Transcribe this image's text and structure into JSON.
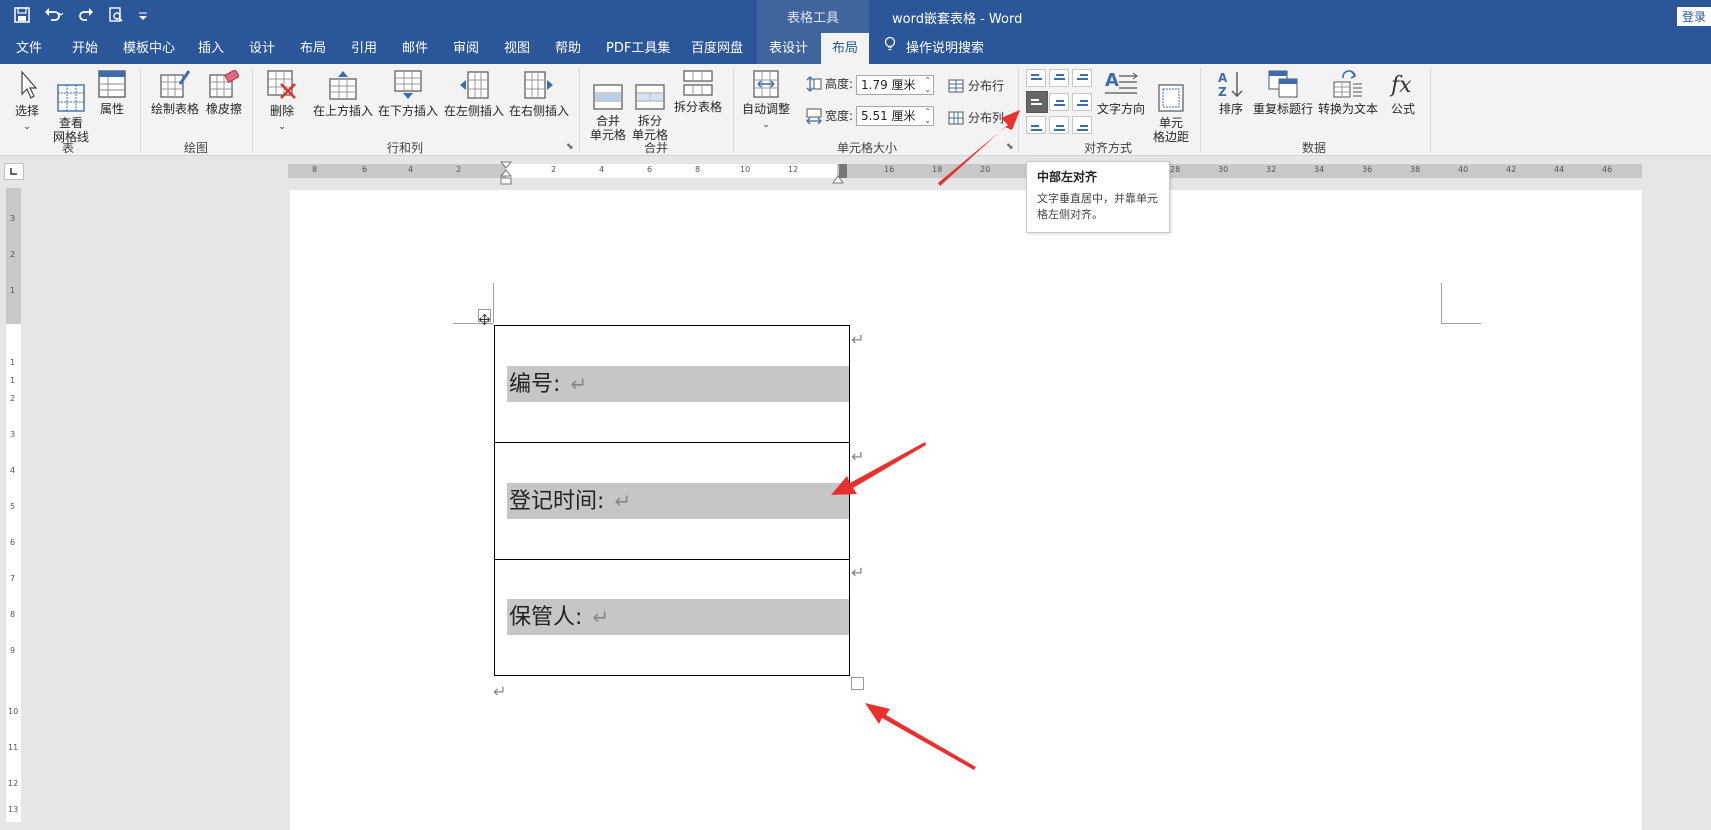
{
  "titlebar": {
    "context_tool": "表格工具",
    "document_title": "word嵌套表格  -  Word",
    "login": "登录",
    "qat_icons": [
      "save-icon",
      "undo-icon",
      "redo-icon",
      "print-preview-icon",
      "customize-icon"
    ]
  },
  "tabs": [
    {
      "label": "文件"
    },
    {
      "label": "开始"
    },
    {
      "label": "模板中心"
    },
    {
      "label": "插入"
    },
    {
      "label": "设计"
    },
    {
      "label": "布局"
    },
    {
      "label": "引用"
    },
    {
      "label": "邮件"
    },
    {
      "label": "审阅"
    },
    {
      "label": "视图"
    },
    {
      "label": "帮助"
    },
    {
      "label": "PDF工具集"
    },
    {
      "label": "百度网盘"
    },
    {
      "label": "表设计"
    },
    {
      "label": "布局"
    }
  ],
  "search_tab": "操作说明搜索",
  "ribbon": {
    "select": "选择",
    "view_grid": "查看\n网格线",
    "properties": "属性",
    "group_table": "表",
    "draw_table": "绘制表格",
    "eraser": "橡皮擦",
    "group_draw": "绘图",
    "delete": "删除",
    "insert_above": "在上方插入",
    "insert_below": "在下方插入",
    "insert_left": "在左侧插入",
    "insert_right": "在右侧插入",
    "group_rows_cols": "行和列",
    "merge_cells": "合并\n单元格",
    "split_cells": "拆分\n单元格",
    "split_table": "拆分表格",
    "group_merge": "合并",
    "autofit": "自动调整",
    "height_label": "高度:",
    "height_value": "1.79 厘米",
    "width_label": "宽度:",
    "width_value": "5.51 厘米",
    "distribute_rows": "分布行",
    "distribute_cols": "分布列",
    "group_cell_size": "单元格大小",
    "text_direction": "文字方向",
    "cell_margins": "单元\n格边距",
    "group_alignment": "对齐方式",
    "sort": "排序",
    "repeat_header": "重复标题行",
    "convert_text": "转换为文本",
    "formula": "公式",
    "group_data": "数据"
  },
  "ruler_ticks": [
    "8",
    "6",
    "4",
    "2",
    "2",
    "4",
    "6",
    "8",
    "10",
    "12",
    "16",
    "18",
    "20",
    "28",
    "30",
    "32",
    "34",
    "36",
    "38",
    "40",
    "42",
    "44",
    "46"
  ],
  "vruler_ticks": [
    "3",
    "2",
    "1",
    "1",
    "1",
    "2",
    "3",
    "4",
    "5",
    "6",
    "7",
    "8",
    "9",
    "10",
    "11",
    "12",
    "13"
  ],
  "tooltip": {
    "title": "中部左对齐",
    "description": "文字垂直居中，并靠单元格左侧对齐。"
  },
  "table": {
    "rows": [
      {
        "text": "编号:"
      },
      {
        "text": "登记时间:"
      },
      {
        "text": "保管人:"
      }
    ],
    "para_mark": "↵"
  },
  "colors": {
    "accent": "#2b579a",
    "context": "#40659c",
    "arrow": "#e8312f",
    "highlight": "#c6c6c6"
  }
}
